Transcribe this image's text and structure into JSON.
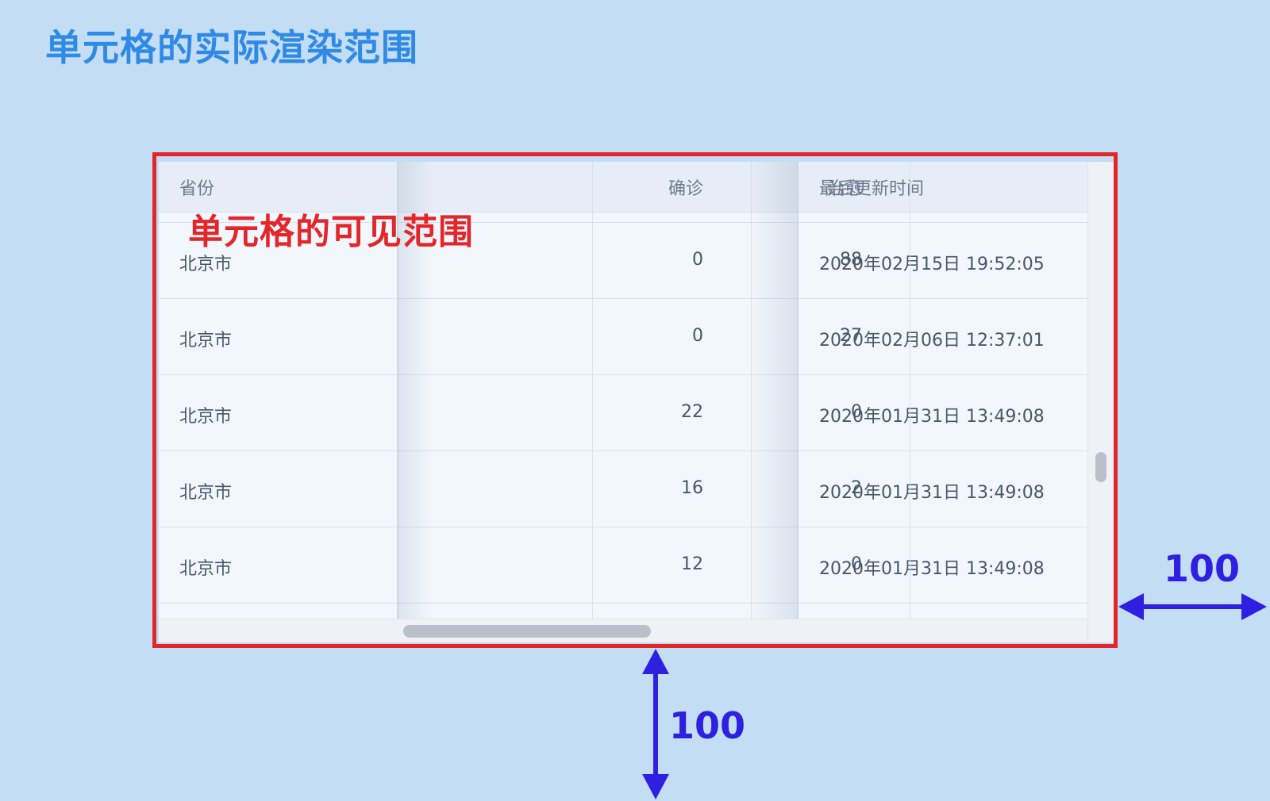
{
  "title": "单元格的实际渲染范围",
  "visible_label": "单元格的可见范围",
  "table": {
    "headers": [
      "省份",
      "确诊",
      "治愈",
      "最后更新时间"
    ],
    "rows": [
      [
        "北京市",
        "0",
        "88",
        "2020年02月15日 19:52:05"
      ],
      [
        "北京市",
        "0",
        "27",
        "2020年02月06日 12:37:01"
      ],
      [
        "北京市",
        "22",
        "0",
        "2020年01月31日 13:49:08"
      ],
      [
        "北京市",
        "16",
        "2",
        "2020年01月31日 13:49:08"
      ],
      [
        "北京市",
        "12",
        "0",
        "2020年01月31日 13:49:08"
      ]
    ]
  },
  "dimensions": {
    "right": "100",
    "bottom": "100"
  },
  "colors": {
    "background": "#c3ddf4",
    "title": "#2f8ae6",
    "highlight_border": "#e3262a",
    "arrow": "#2f1fe0"
  }
}
